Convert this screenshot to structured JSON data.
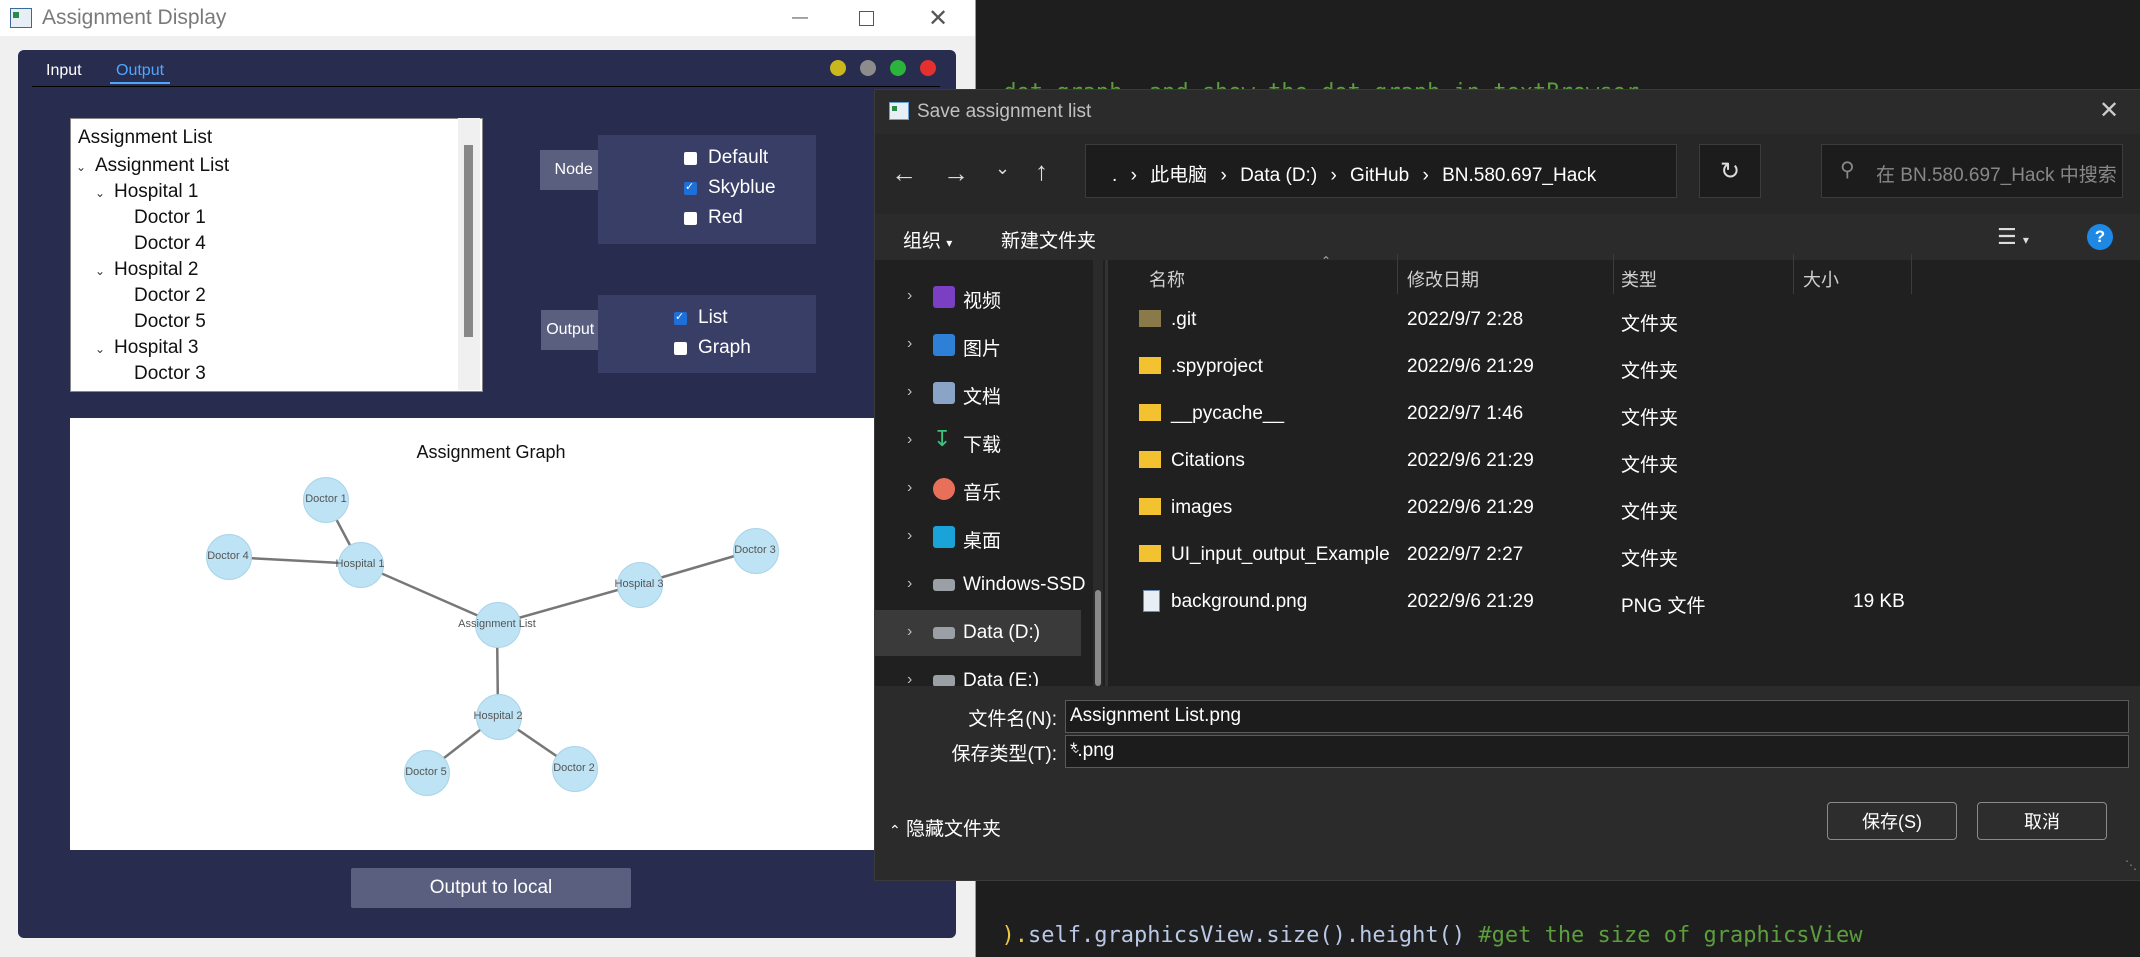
{
  "editor": {
    "line1": ".dot graph, and show the dot graph in textBrowser",
    "line2_paren": ").",
    "line2_code": "self.graphicsView.size().height() ",
    "line2_comment": "#get the size of graphicsView"
  },
  "left_window": {
    "title": "Assignment Display",
    "tabs": [
      "Input",
      "Output"
    ],
    "active_tab": "Output",
    "tree": {
      "header": "Assignment List",
      "items": [
        "Assignment List",
        "Hospital 1",
        "Doctor 1",
        "Doctor 4",
        "Hospital 2",
        "Doctor 2",
        "Doctor 5",
        "Hospital 3",
        "Doctor 3"
      ]
    },
    "node_color": {
      "label": "Node Color",
      "options": [
        "Default",
        "Skyblue",
        "Red"
      ],
      "checked": "Skyblue"
    },
    "output_option": {
      "label": "Output Option",
      "options": [
        "List",
        "Graph"
      ],
      "checked": "List"
    },
    "graph": {
      "title": "Assignment Graph",
      "nodes": [
        "Doctor 1",
        "Doctor 4",
        "Hospital 1",
        "Assignment List",
        "Hospital 3",
        "Doctor 3",
        "Hospital 2",
        "Doctor 5",
        "Doctor 2"
      ],
      "edges": [
        [
          "Hospital 1",
          "Doctor 1"
        ],
        [
          "Hospital 1",
          "Doctor 4"
        ],
        [
          "Assignment List",
          "Hospital 1"
        ],
        [
          "Assignment List",
          "Hospital 3"
        ],
        [
          "Hospital 3",
          "Doctor 3"
        ],
        [
          "Assignment List",
          "Hospital 2"
        ],
        [
          "Hospital 2",
          "Doctor 5"
        ],
        [
          "Hospital 2",
          "Doctor 2"
        ]
      ]
    },
    "output_button": "Output to local",
    "dot_colors": [
      "#c8b81e",
      "#8c8c8c",
      "#2bb33b",
      "#e53030"
    ]
  },
  "dialog": {
    "title": "Save assignment list",
    "breadcrumb": [
      ".",
      "此电脑",
      "Data (D:)",
      "GitHub",
      "BN.580.697_Hack"
    ],
    "search_placeholder": "在 BN.580.697_Hack 中搜索",
    "toolbar": {
      "organize": "组织",
      "new_folder": "新建文件夹"
    },
    "nav": [
      {
        "label": "视频",
        "icon": "video-icon"
      },
      {
        "label": "图片",
        "icon": "pictures-icon"
      },
      {
        "label": "文档",
        "icon": "documents-icon"
      },
      {
        "label": "下载",
        "icon": "download-icon"
      },
      {
        "label": "音乐",
        "icon": "music-icon"
      },
      {
        "label": "桌面",
        "icon": "desktop-icon"
      },
      {
        "label": "Windows-SSD",
        "icon": "drive-icon"
      },
      {
        "label": "Data (D:)",
        "icon": "drive-icon"
      },
      {
        "label": "Data (E:)",
        "icon": "drive-icon"
      }
    ],
    "nav_selected": "Data (D:)",
    "columns": [
      "名称",
      "修改日期",
      "类型",
      "大小"
    ],
    "files": [
      {
        "name": ".git",
        "date": "2022/9/7 2:28",
        "type": "文件夹",
        "size": "",
        "icon": "folder-icon"
      },
      {
        "name": ".spyproject",
        "date": "2022/9/6 21:29",
        "type": "文件夹",
        "size": "",
        "icon": "folder-icon"
      },
      {
        "name": "__pycache__",
        "date": "2022/9/7 1:46",
        "type": "文件夹",
        "size": "",
        "icon": "folder-icon"
      },
      {
        "name": "Citations",
        "date": "2022/9/6 21:29",
        "type": "文件夹",
        "size": "",
        "icon": "folder-icon"
      },
      {
        "name": "images",
        "date": "2022/9/6 21:29",
        "type": "文件夹",
        "size": "",
        "icon": "folder-icon"
      },
      {
        "name": "UI_input_output_Example",
        "date": "2022/9/7 2:27",
        "type": "文件夹",
        "size": "",
        "icon": "folder-icon"
      },
      {
        "name": "background.png",
        "date": "2022/9/6 21:29",
        "type": "PNG 文件",
        "size": "19 KB",
        "icon": "png-file-icon"
      }
    ],
    "filename_label": "文件名(N):",
    "filename_value": "Assignment List.png",
    "filetype_label": "保存类型(T):",
    "filetype_value": "*.png",
    "hide_folders": "隐藏文件夹",
    "save_button": "保存(S)",
    "cancel_button": "取消"
  }
}
